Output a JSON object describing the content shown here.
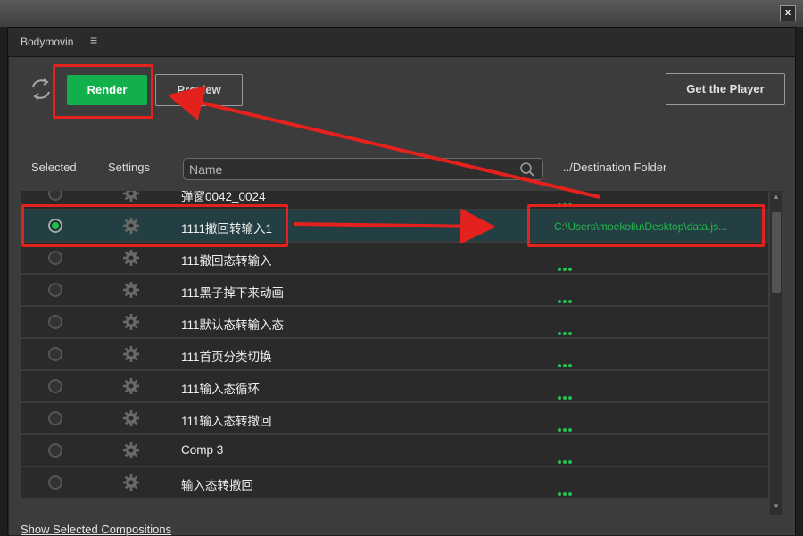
{
  "window": {
    "close_label": "x"
  },
  "panel": {
    "title": "Bodymovin",
    "menu_icon": "hamburger-menu-icon"
  },
  "toolbar": {
    "refresh_icon": "refresh-icon",
    "render_label": "Render",
    "preview_label": "Preview",
    "get_player_label": "Get the Player"
  },
  "colors": {
    "accent": "#11b04a",
    "path_green": "#23b84b",
    "annotation": "#e4211c",
    "selected_row": "#233f44"
  },
  "table": {
    "headers": {
      "selected": "Selected",
      "settings": "Settings",
      "destination": "../Destination Folder"
    },
    "search": {
      "placeholder": "Name",
      "value": ""
    },
    "rows": [
      {
        "name": "弹窗0042_0024",
        "selected": false,
        "destination": "..."
      },
      {
        "name": "1111撤回转输入1",
        "selected": true,
        "destination": "C:\\Users\\moekoliu\\Desktop\\data.js..."
      },
      {
        "name": "111撤回态转输入",
        "selected": false,
        "destination": "..."
      },
      {
        "name": "111黑子掉下来动画",
        "selected": false,
        "destination": "..."
      },
      {
        "name": "111默认态转输入态",
        "selected": false,
        "destination": "..."
      },
      {
        "name": "111首页分类切换",
        "selected": false,
        "destination": "..."
      },
      {
        "name": "111输入态循环",
        "selected": false,
        "destination": "..."
      },
      {
        "name": "111输入态转撤回",
        "selected": false,
        "destination": "..."
      },
      {
        "name": "Comp 3",
        "selected": false,
        "destination": "..."
      },
      {
        "name": "输入态转撤回",
        "selected": false,
        "destination": "..."
      }
    ]
  },
  "footer": {
    "show_selected_label": "Show Selected Compositions"
  }
}
